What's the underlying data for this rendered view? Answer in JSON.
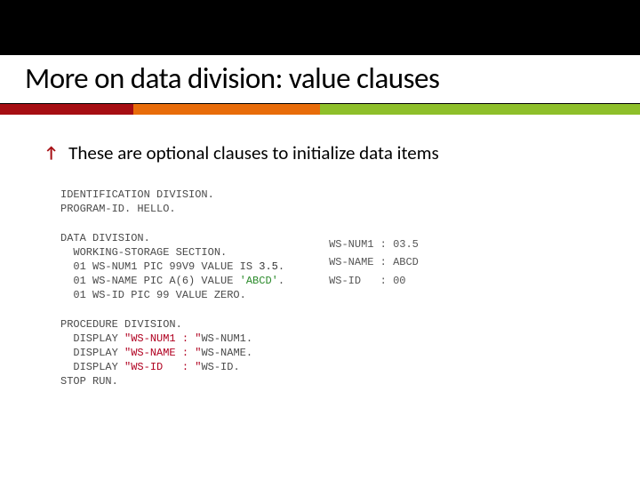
{
  "slide": {
    "title": "More on data division: value clauses",
    "bullet_icon": "↗",
    "bullet_text": "These are optional clauses to initialize data items",
    "code": {
      "l1": "IDENTIFICATION DIVISION.",
      "l2": "PROGRAM-ID. HELLO.",
      "l3": "",
      "l4": "DATA DIVISION.",
      "l5": "  WORKING-STORAGE SECTION.",
      "l6a": "  01 WS-NUM1 PIC 99V9 VALUE IS ",
      "l6b": "3.5",
      "l6c": ".",
      "l7a": "  01 WS-NAME PIC A(6) VALUE ",
      "l7b": "'ABCD'",
      "l7c": ".",
      "l8": "  01 WS-ID PIC 99 VALUE ZERO.",
      "l9": "",
      "l10": "PROCEDURE DIVISION.",
      "l11a": "  DISPLAY ",
      "l11b": "\"WS-NUM1 : \"",
      "l11c": "WS-NUM1.",
      "l12a": "  DISPLAY ",
      "l12b": "\"WS-NAME : \"",
      "l12c": "WS-NAME.",
      "l13a": "  DISPLAY ",
      "l13b": "\"WS-ID   : \"",
      "l13c": "WS-ID.",
      "l14": "STOP RUN."
    },
    "output": {
      "l1": "WS-NUM1 : 03.5",
      "l2": "WS-NAME : ABCD",
      "l3": "WS-ID   : 00"
    }
  },
  "colors": {
    "bar1": "#a60e13",
    "bar2": "#e86c0a",
    "bar3": "#8ebf2a"
  }
}
